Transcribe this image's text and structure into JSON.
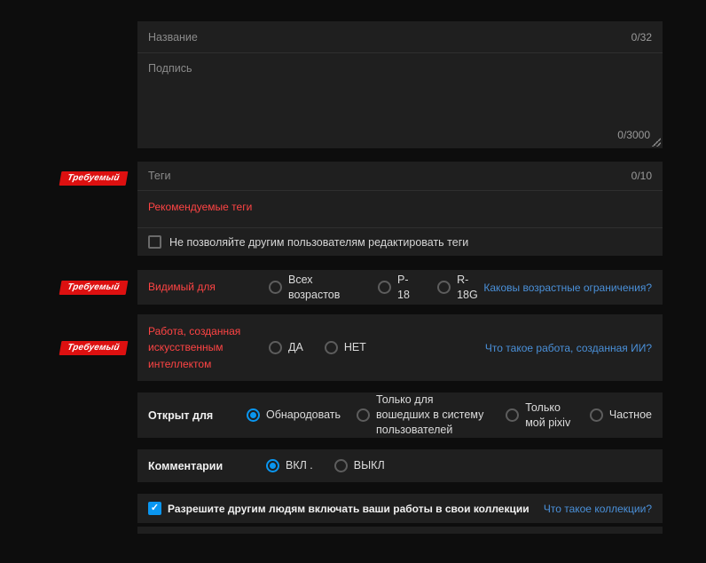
{
  "colors": {
    "page_bg": "#0d0d0d",
    "panel_bg": "#1f1f1f",
    "accent_red": "#dd1010",
    "red_text": "#ff4444",
    "link_blue": "#4a90d9",
    "control_blue": "#0a96f0"
  },
  "icons": {
    "check": "✓"
  },
  "required_badge": "Требуемый",
  "title": {
    "placeholder": "Название",
    "counter": "0/32"
  },
  "caption": {
    "placeholder": "Подпись",
    "counter": "0/3000"
  },
  "tags": {
    "placeholder": "Теги",
    "counter": "0/10",
    "recommended_label": "Рекомендуемые теги",
    "lock_label": "Не позволяйте другим пользователям редактировать теги",
    "lock_checked": false
  },
  "age_restriction": {
    "label": "Видимый для",
    "options": [
      {
        "label": "Всех возрастов",
        "selected": false
      },
      {
        "label": "P-18",
        "selected": false
      },
      {
        "label": "R-18G",
        "selected": false
      }
    ],
    "help_link": "Каковы возрастные ограничения?"
  },
  "ai_generated": {
    "label": "Работа, созданная искусственным интеллектом",
    "options": [
      {
        "label": "ДА",
        "selected": false
      },
      {
        "label": "НЕТ",
        "selected": false
      }
    ],
    "help_link": "Что такое работа, созданная ИИ?"
  },
  "publish_scope": {
    "label": "Открыт для",
    "options": [
      {
        "label": "Обнародовать",
        "selected": true
      },
      {
        "label": "Только для вошедших в систему пользователей",
        "selected": false
      },
      {
        "label": "Только мой pixiv",
        "selected": false
      },
      {
        "label": "Частное",
        "selected": false
      }
    ]
  },
  "comments": {
    "label": "Комментарии",
    "options": [
      {
        "label": "ВКЛ .",
        "selected": true
      },
      {
        "label": "ВЫКЛ",
        "selected": false
      }
    ]
  },
  "collections": {
    "label": "Разрешите другим людям включать ваши работы в свои коллекции",
    "checked": true,
    "help_link": "Что такое коллекции?"
  }
}
